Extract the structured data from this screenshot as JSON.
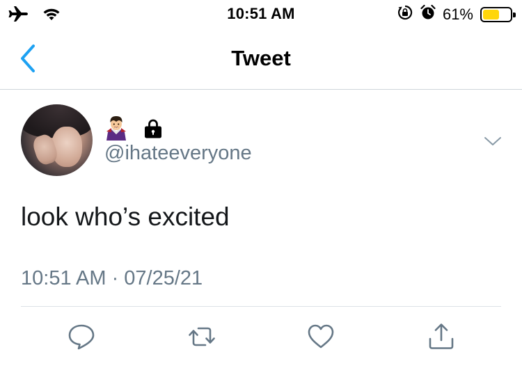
{
  "status_bar": {
    "time": "10:51 AM",
    "battery_percent_label": "61%",
    "battery_level": 0.61,
    "battery_color": "#ffd60a",
    "icons": [
      "airplane-icon",
      "wifi-icon",
      "orientation-lock-icon",
      "alarm-icon",
      "battery-icon"
    ]
  },
  "nav": {
    "title": "Tweet",
    "back_icon": "chevron-left-icon",
    "accent_color": "#1da1f2"
  },
  "tweet": {
    "display_name_icons": [
      "vampire-emoji-icon",
      "lock-icon"
    ],
    "handle": "@ihateeveryone",
    "text": "look who’s excited",
    "meta": "10:51 AM · 07/25/21",
    "secondary_text_color": "#657786"
  },
  "actions": [
    {
      "name": "reply",
      "icon": "reply-icon"
    },
    {
      "name": "retweet",
      "icon": "retweet-icon"
    },
    {
      "name": "like",
      "icon": "heart-icon"
    },
    {
      "name": "share",
      "icon": "share-icon"
    }
  ]
}
